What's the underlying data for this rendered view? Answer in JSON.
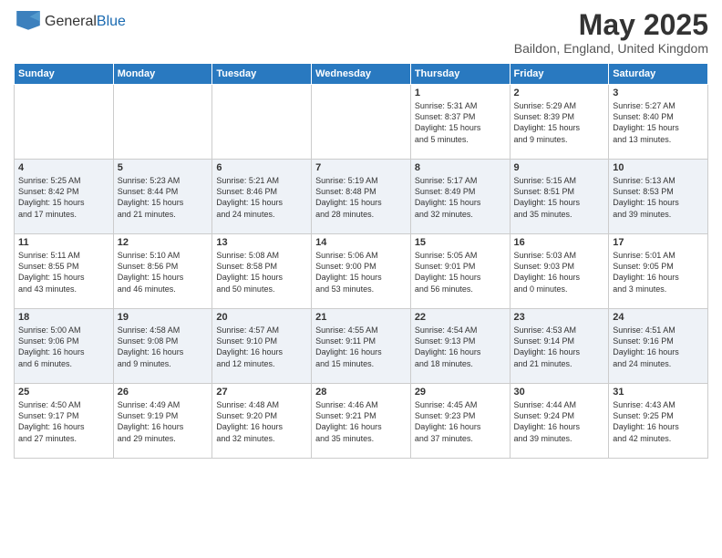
{
  "logo": {
    "general": "General",
    "blue": "Blue"
  },
  "title": "May 2025",
  "location": "Baildon, England, United Kingdom",
  "days_of_week": [
    "Sunday",
    "Monday",
    "Tuesday",
    "Wednesday",
    "Thursday",
    "Friday",
    "Saturday"
  ],
  "weeks": [
    [
      {
        "day": "",
        "info": ""
      },
      {
        "day": "",
        "info": ""
      },
      {
        "day": "",
        "info": ""
      },
      {
        "day": "",
        "info": ""
      },
      {
        "day": "1",
        "info": "Sunrise: 5:31 AM\nSunset: 8:37 PM\nDaylight: 15 hours\nand 5 minutes."
      },
      {
        "day": "2",
        "info": "Sunrise: 5:29 AM\nSunset: 8:39 PM\nDaylight: 15 hours\nand 9 minutes."
      },
      {
        "day": "3",
        "info": "Sunrise: 5:27 AM\nSunset: 8:40 PM\nDaylight: 15 hours\nand 13 minutes."
      }
    ],
    [
      {
        "day": "4",
        "info": "Sunrise: 5:25 AM\nSunset: 8:42 PM\nDaylight: 15 hours\nand 17 minutes."
      },
      {
        "day": "5",
        "info": "Sunrise: 5:23 AM\nSunset: 8:44 PM\nDaylight: 15 hours\nand 21 minutes."
      },
      {
        "day": "6",
        "info": "Sunrise: 5:21 AM\nSunset: 8:46 PM\nDaylight: 15 hours\nand 24 minutes."
      },
      {
        "day": "7",
        "info": "Sunrise: 5:19 AM\nSunset: 8:48 PM\nDaylight: 15 hours\nand 28 minutes."
      },
      {
        "day": "8",
        "info": "Sunrise: 5:17 AM\nSunset: 8:49 PM\nDaylight: 15 hours\nand 32 minutes."
      },
      {
        "day": "9",
        "info": "Sunrise: 5:15 AM\nSunset: 8:51 PM\nDaylight: 15 hours\nand 35 minutes."
      },
      {
        "day": "10",
        "info": "Sunrise: 5:13 AM\nSunset: 8:53 PM\nDaylight: 15 hours\nand 39 minutes."
      }
    ],
    [
      {
        "day": "11",
        "info": "Sunrise: 5:11 AM\nSunset: 8:55 PM\nDaylight: 15 hours\nand 43 minutes."
      },
      {
        "day": "12",
        "info": "Sunrise: 5:10 AM\nSunset: 8:56 PM\nDaylight: 15 hours\nand 46 minutes."
      },
      {
        "day": "13",
        "info": "Sunrise: 5:08 AM\nSunset: 8:58 PM\nDaylight: 15 hours\nand 50 minutes."
      },
      {
        "day": "14",
        "info": "Sunrise: 5:06 AM\nSunset: 9:00 PM\nDaylight: 15 hours\nand 53 minutes."
      },
      {
        "day": "15",
        "info": "Sunrise: 5:05 AM\nSunset: 9:01 PM\nDaylight: 15 hours\nand 56 minutes."
      },
      {
        "day": "16",
        "info": "Sunrise: 5:03 AM\nSunset: 9:03 PM\nDaylight: 16 hours\nand 0 minutes."
      },
      {
        "day": "17",
        "info": "Sunrise: 5:01 AM\nSunset: 9:05 PM\nDaylight: 16 hours\nand 3 minutes."
      }
    ],
    [
      {
        "day": "18",
        "info": "Sunrise: 5:00 AM\nSunset: 9:06 PM\nDaylight: 16 hours\nand 6 minutes."
      },
      {
        "day": "19",
        "info": "Sunrise: 4:58 AM\nSunset: 9:08 PM\nDaylight: 16 hours\nand 9 minutes."
      },
      {
        "day": "20",
        "info": "Sunrise: 4:57 AM\nSunset: 9:10 PM\nDaylight: 16 hours\nand 12 minutes."
      },
      {
        "day": "21",
        "info": "Sunrise: 4:55 AM\nSunset: 9:11 PM\nDaylight: 16 hours\nand 15 minutes."
      },
      {
        "day": "22",
        "info": "Sunrise: 4:54 AM\nSunset: 9:13 PM\nDaylight: 16 hours\nand 18 minutes."
      },
      {
        "day": "23",
        "info": "Sunrise: 4:53 AM\nSunset: 9:14 PM\nDaylight: 16 hours\nand 21 minutes."
      },
      {
        "day": "24",
        "info": "Sunrise: 4:51 AM\nSunset: 9:16 PM\nDaylight: 16 hours\nand 24 minutes."
      }
    ],
    [
      {
        "day": "25",
        "info": "Sunrise: 4:50 AM\nSunset: 9:17 PM\nDaylight: 16 hours\nand 27 minutes."
      },
      {
        "day": "26",
        "info": "Sunrise: 4:49 AM\nSunset: 9:19 PM\nDaylight: 16 hours\nand 29 minutes."
      },
      {
        "day": "27",
        "info": "Sunrise: 4:48 AM\nSunset: 9:20 PM\nDaylight: 16 hours\nand 32 minutes."
      },
      {
        "day": "28",
        "info": "Sunrise: 4:46 AM\nSunset: 9:21 PM\nDaylight: 16 hours\nand 35 minutes."
      },
      {
        "day": "29",
        "info": "Sunrise: 4:45 AM\nSunset: 9:23 PM\nDaylight: 16 hours\nand 37 minutes."
      },
      {
        "day": "30",
        "info": "Sunrise: 4:44 AM\nSunset: 9:24 PM\nDaylight: 16 hours\nand 39 minutes."
      },
      {
        "day": "31",
        "info": "Sunrise: 4:43 AM\nSunset: 9:25 PM\nDaylight: 16 hours\nand 42 minutes."
      }
    ]
  ]
}
